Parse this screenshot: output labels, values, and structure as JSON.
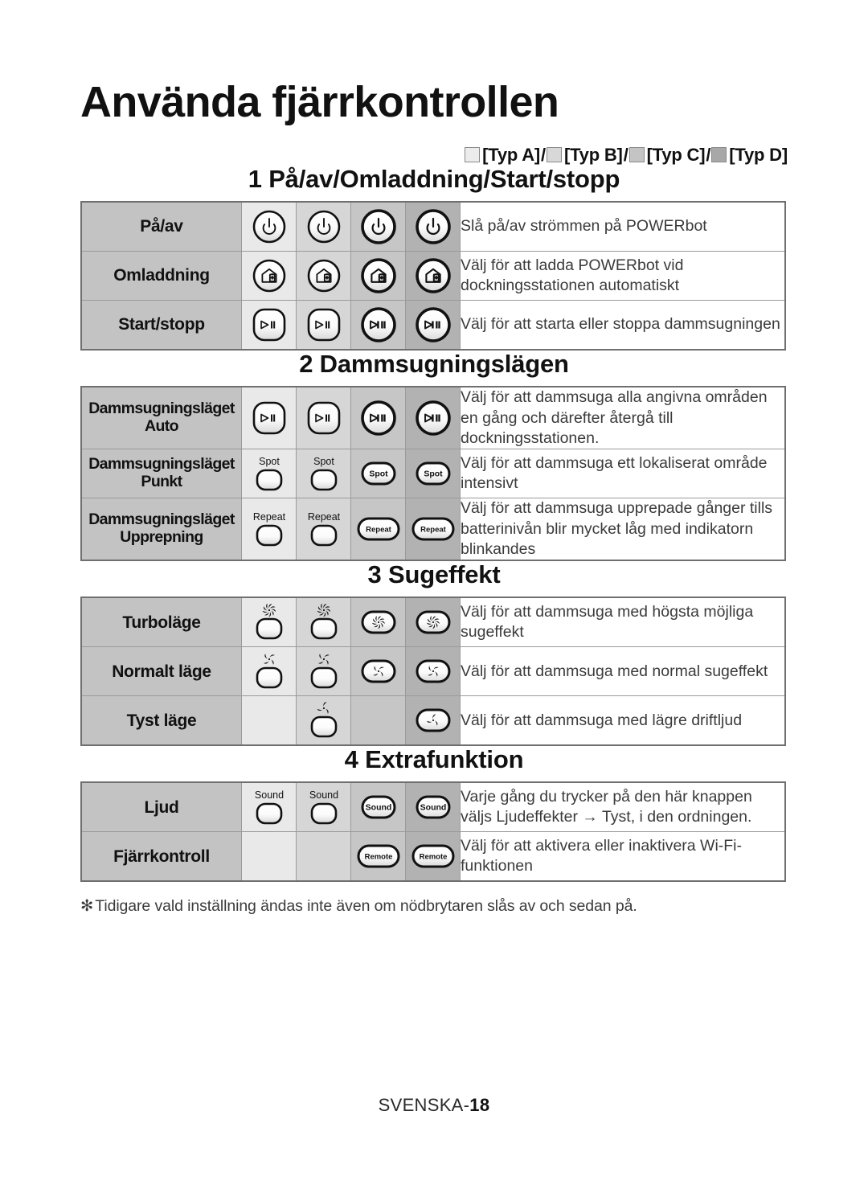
{
  "document": {
    "title": "Använda fjärrkontrollen",
    "page_label_prefix": "SVENSKA-",
    "page_number": "18",
    "footnote": "Tidigare vald inställning ändas inte även om nödbrytaren slås av och sedan på.",
    "footnote_marker": "✻"
  },
  "legend": {
    "types": [
      {
        "label": "[Typ A]",
        "swatch": "#ececec"
      },
      {
        "label": "[Typ B]",
        "swatch": "#d8d8d8"
      },
      {
        "label": "[Typ C]",
        "swatch": "#c4c4c4"
      },
      {
        "label": "[Typ D]",
        "swatch": "#a8a8a8"
      }
    ],
    "separator": "/"
  },
  "sections": [
    {
      "heading": "1 På/av/Omladdning/Start/stopp",
      "rows": [
        {
          "label": "På/av",
          "label_line2": "",
          "icons": [
            "power",
            "power",
            "power",
            "power"
          ],
          "description": "Slå på/av strömmen på POWERbot"
        },
        {
          "label": "Omladdning",
          "label_line2": "",
          "icons": [
            "home-charge",
            "home-charge",
            "home-charge",
            "home-charge"
          ],
          "description": "Välj för att ladda POWERbot vid dockningsstationen automatiskt"
        },
        {
          "label": "Start/stopp",
          "label_line2": "",
          "icons": [
            "play-pause",
            "play-pause",
            "play-pause",
            "play-pause"
          ],
          "description": "Välj för att starta eller stoppa dammsugningen"
        }
      ]
    },
    {
      "heading": "2 Dammsugningslägen",
      "rows": [
        {
          "label": "Dammsugningsläget",
          "label_line2": "Auto",
          "icons": [
            "play-pause",
            "play-pause",
            "play-pause",
            "play-pause"
          ],
          "description": "Välj för att dammsuga alla angivna områden en gång och därefter återgå till dockningsstationen."
        },
        {
          "label": "Dammsugningsläget",
          "label_line2": "Punkt",
          "icons": [
            "text:Spot",
            "text:Spot",
            "text:Spot",
            "text:Spot"
          ],
          "description": "Välj för att dammsuga ett lokaliserat område intensivt"
        },
        {
          "label": "Dammsugningsläget",
          "label_line2": "Upprepning",
          "icons": [
            "text:Repeat",
            "text:Repeat",
            "text:Repeat",
            "text:Repeat"
          ],
          "description": "Välj för att dammsuga upprepade gånger tills batterinivån blir mycket låg med indikatorn blinkandes"
        }
      ]
    },
    {
      "heading": "3 Sugeffekt",
      "rows": [
        {
          "label": "Turboläge",
          "label_line2": "",
          "icons": [
            "fan-turbo",
            "fan-turbo",
            "fan-turbo",
            "fan-turbo"
          ],
          "description": "Välj för att dammsuga med högsta möjliga sugeffekt"
        },
        {
          "label": "Normalt läge",
          "label_line2": "",
          "icons": [
            "fan-normal",
            "fan-normal",
            "fan-normal",
            "fan-normal"
          ],
          "description": "Välj för att dammsuga med normal sugeffekt"
        },
        {
          "label": "Tyst läge",
          "label_line2": "",
          "icons": [
            "",
            "fan-silent",
            "",
            "fan-silent"
          ],
          "description": "Välj för att dammsuga med lägre driftljud"
        }
      ]
    },
    {
      "heading": "4 Extrafunktion",
      "rows": [
        {
          "label": "Ljud",
          "label_line2": "",
          "icons": [
            "text:Sound",
            "text:Sound",
            "text:Sound",
            "text:Sound"
          ],
          "description": "Varje gång du trycker på den här knappen väljs Ljudeffekter → Tyst, i den ordningen."
        },
        {
          "label": "Fjärrkontroll",
          "label_line2": "",
          "icons": [
            "",
            "",
            "text:Remote",
            "text:Remote"
          ],
          "description": "Välj för att aktivera eller inaktivera Wi-Fi-funktionen"
        }
      ]
    }
  ]
}
